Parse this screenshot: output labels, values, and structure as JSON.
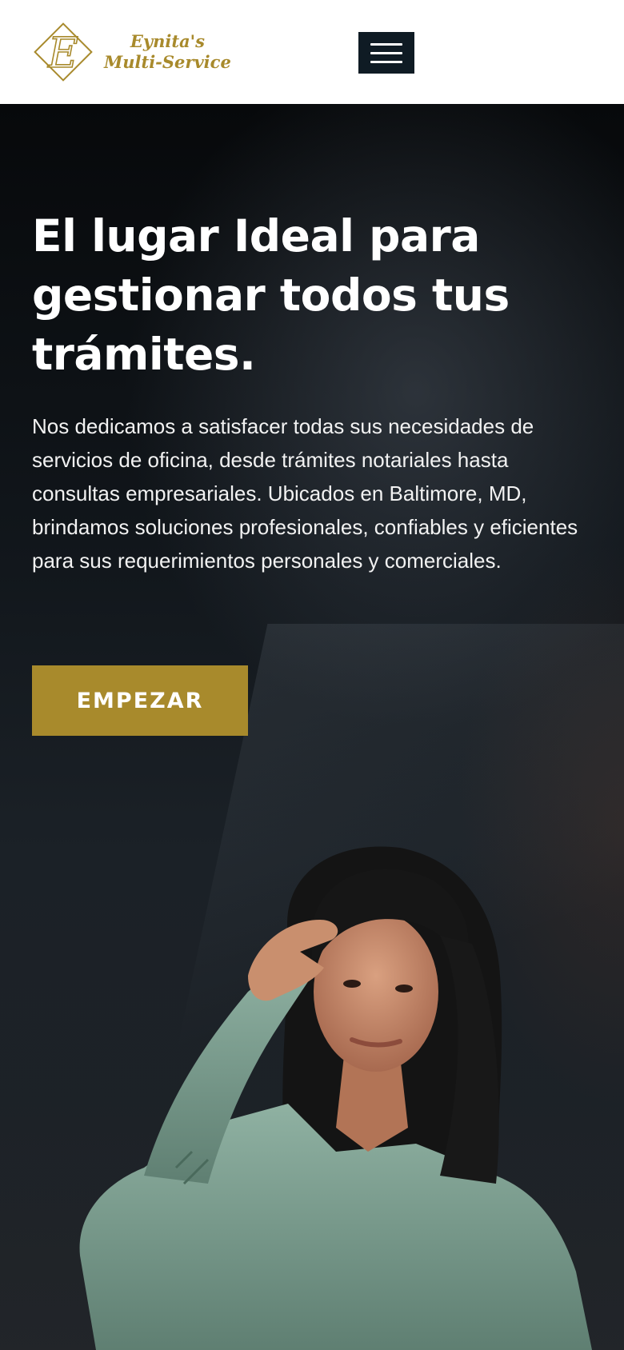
{
  "header": {
    "logo_initial": "E",
    "logo_line1": "Eynita's",
    "logo_line2": "Multi-Service",
    "menu_icon": "hamburger-menu-icon"
  },
  "hero": {
    "headline_before": "El lugar ",
    "headline_highlight": "Ideal",
    "headline_after": " para gestionar todos tus trámites.",
    "description": "Nos dedicamos a satisfacer todas sus necesidades de servicios de oficina, desde trámites notariales hasta consultas empresariales. Ubicados  en Baltimore, MD, brindamos soluciones profesionales, confiables y eficientes para sus requerimientos personales y comerciales.",
    "cta_label": "EMPEZAR"
  },
  "colors": {
    "accent": "#a88a2c",
    "menu_bg": "#0f1b24",
    "header_bg": "#ffffff",
    "hero_bg": "#0b0e11"
  }
}
